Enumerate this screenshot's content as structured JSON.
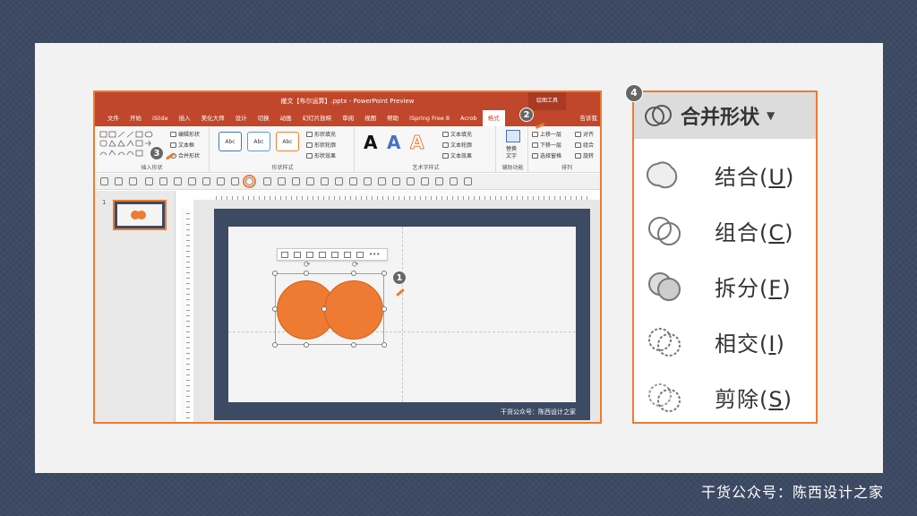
{
  "footer": {
    "brand": "干货公众号：陈西设计之家"
  },
  "ppt": {
    "title": "撤文【布尔运算】.pptx - PowerPoint Preview",
    "context_tab": "绘图工具",
    "tabs": [
      "文件",
      "开始",
      "iSlide",
      "插入",
      "美化大师",
      "设计",
      "切换",
      "动画",
      "幻灯片放映",
      "审阅",
      "视图",
      "帮助",
      "iSpring Free 8",
      "Acrob",
      "格式"
    ],
    "active_tab": "格式",
    "tell_me": "告诉我",
    "ribbon": {
      "insert_shapes": {
        "label": "插入形状",
        "edit_shape": "编辑形状",
        "text_box": "文本框",
        "merge_shapes": "合并形状"
      },
      "shape_styles": {
        "label": "形状样式",
        "sample": "Abc",
        "fill": "形状填充",
        "outline": "形状轮廓",
        "effects": "形状效果"
      },
      "wordart": {
        "label": "艺术字样式",
        "sample": "A",
        "text_fill": "文本填充",
        "text_outline": "文本轮廓",
        "text_effects": "文本效果"
      },
      "accessibility": {
        "label": "辅助功能",
        "alt_text_1": "替换",
        "alt_text_2": "文字"
      },
      "arrange": {
        "label": "排列",
        "bring_forward": "上移一层",
        "send_backward": "下移一层",
        "selection_pane": "选择窗格",
        "align": "对齐",
        "group": "组合",
        "rotate": "旋转"
      }
    },
    "thumbnail_number": "1",
    "slide_brand": "干货公众号：陈西设计之家"
  },
  "markers": [
    "1",
    "2",
    "3",
    "4"
  ],
  "zoom": {
    "header": "合并形状",
    "items": [
      {
        "label": "结合",
        "key": "U"
      },
      {
        "label": "组合",
        "key": "C"
      },
      {
        "label": "拆分",
        "key": "F"
      },
      {
        "label": "相交",
        "key": "I"
      },
      {
        "label": "剪除",
        "key": "S"
      }
    ]
  },
  "colors": {
    "accent": "#ef7b2f",
    "shape_fill": "#ee7b31",
    "title_bar": "#c0472b",
    "background": "#3c4a63"
  }
}
